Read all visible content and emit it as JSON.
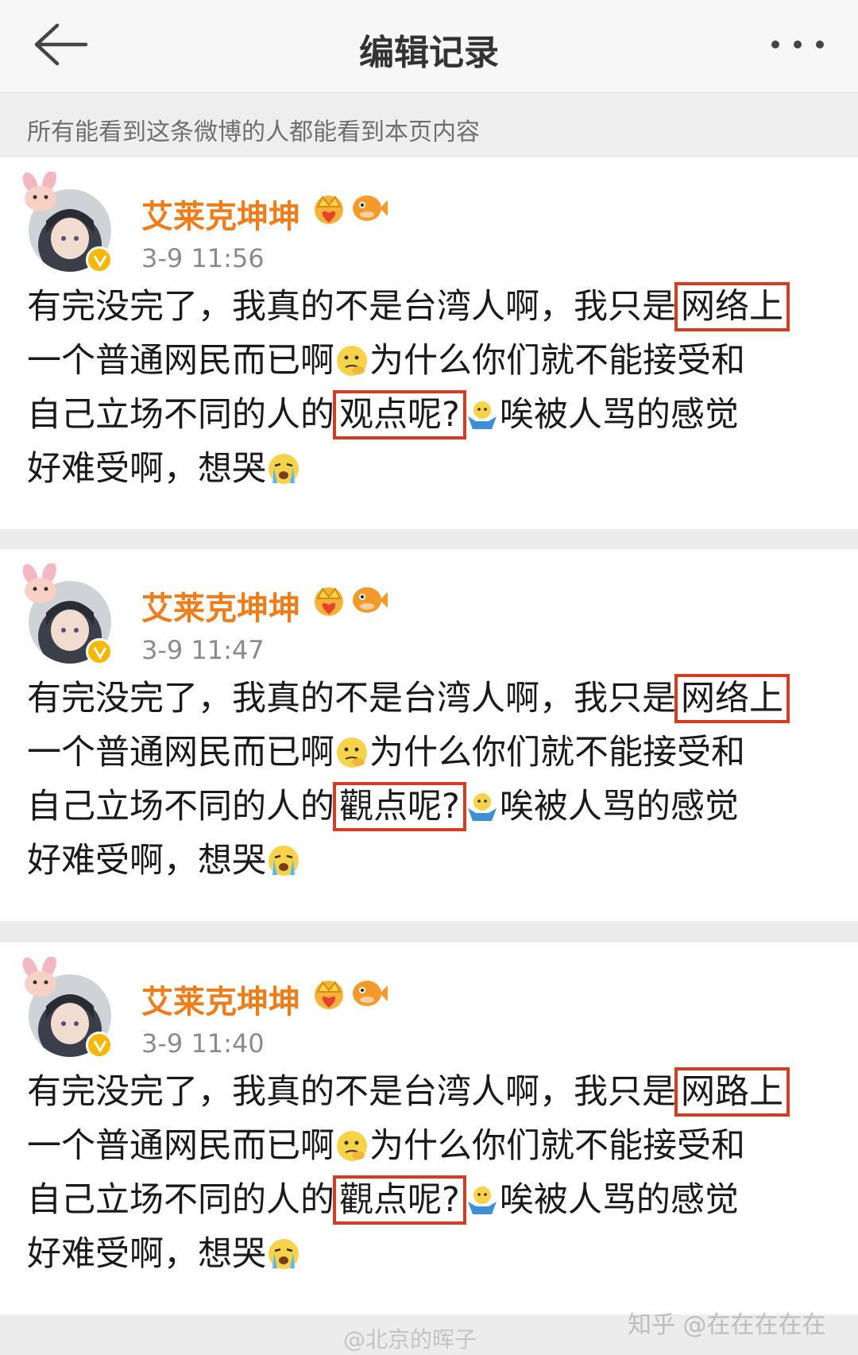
{
  "header": {
    "title": "编辑记录",
    "back_icon": "arrow-left-icon",
    "more_icon": "more-dots-icon"
  },
  "notice": "所有能看到这条微博的人都能看到本页内容",
  "posts": [
    {
      "username": "艾莱克坤坤",
      "timestamp": "3-9 11:56",
      "lines": [
        [
          "有完没完了，我真的不是台湾人啊，我只是",
          "网络上",
          ""
        ],
        [
          "一个普通网民而已啊",
          "为什么你们就不能接受和"
        ],
        [
          "自己立场不同的人的",
          "观点呢?",
          "唉被人骂的感觉"
        ],
        [
          "好难受啊，想哭"
        ]
      ]
    },
    {
      "username": "艾莱克坤坤",
      "timestamp": "3-9 11:47",
      "lines": [
        [
          "有完没完了，我真的不是台湾人啊，我只是",
          "网络上",
          ""
        ],
        [
          "一个普通网民而已啊",
          "为什么你们就不能接受和"
        ],
        [
          "自己立场不同的人的",
          "觀点呢?",
          "唉被人骂的感觉"
        ],
        [
          "好难受啊，想哭"
        ]
      ]
    },
    {
      "username": "艾莱克坤坤",
      "timestamp": "3-9 11:40",
      "lines": [
        [
          "有完没完了，我真的不是台湾人啊，我只是",
          "网路上",
          ""
        ],
        [
          "一个普通网民而已啊",
          "为什么你们就不能接受和"
        ],
        [
          "自己立场不同的人的",
          "觀点呢?",
          "唉被人骂的感觉"
        ],
        [
          "好难受啊，想哭"
        ]
      ]
    }
  ],
  "watermark_zhihu": "知乎 @在在在在在",
  "watermark_weibo": "@北京的晖子",
  "colors": {
    "username": "#ee7d1b",
    "highlight_box": "#d63c22",
    "verified_badge": "#f5b700"
  }
}
